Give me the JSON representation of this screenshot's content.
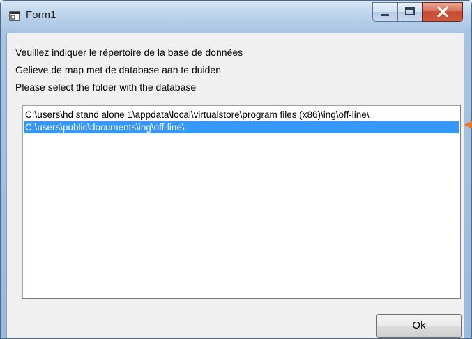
{
  "window": {
    "title": "Form1"
  },
  "caption_buttons": {
    "minimize_icon": "minimize-icon",
    "maximize_icon": "maximize-icon",
    "close_icon": "close-icon"
  },
  "instructions": [
    "Veuillez indiquer le répertoire de la base de données",
    "Gelieve de map met de database aan te duiden",
    "Please select the folder with the database"
  ],
  "folders": {
    "items": [
      "C:\\users\\hd stand alone 1\\appdata\\local\\virtualstore\\program files (x86)\\ing\\off-line\\",
      "C:\\users\\public\\documents\\ing\\off-line\\"
    ],
    "selected": "C:\\users\\public\\documents\\ing\\off-line\\"
  },
  "ok_button": {
    "label": "Ok"
  },
  "colors": {
    "selection": "#3399ff",
    "pointer": "#e8792b",
    "close_button": "#c24a30"
  }
}
